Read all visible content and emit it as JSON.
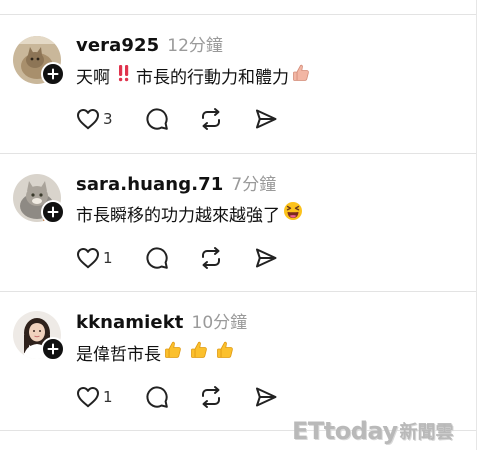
{
  "posts": [
    {
      "username": "vera925",
      "time": "12分鐘",
      "text": "天啊",
      "text_after": "市長的行動力和體力",
      "emojis": [
        "double-exclamation",
        "thumbs-up"
      ],
      "likes": "3",
      "avatar_icon": "cat-avatar"
    },
    {
      "username": "sara.huang.71",
      "time": "7分鐘",
      "text": "市長瞬移的功力越來越強了",
      "emojis": [
        "grinning-squinting-face"
      ],
      "likes": "1",
      "avatar_icon": "cat-avatar"
    },
    {
      "username": "kknamiekt",
      "time": "10分鐘",
      "text": "是偉哲市長",
      "emojis": [
        "thumbs-up",
        "thumbs-up",
        "thumbs-up"
      ],
      "likes": "1",
      "avatar_icon": "woman-avatar"
    }
  ],
  "watermark": {
    "main": "ETtoday",
    "sub": "新聞雲"
  },
  "colors": {
    "text": "#111111",
    "muted": "#9a9a9a",
    "divider": "#e3e3e3",
    "badge": "#111111"
  },
  "icons": [
    "heart-icon",
    "comment-icon",
    "repost-icon",
    "share-icon",
    "plus-icon"
  ]
}
